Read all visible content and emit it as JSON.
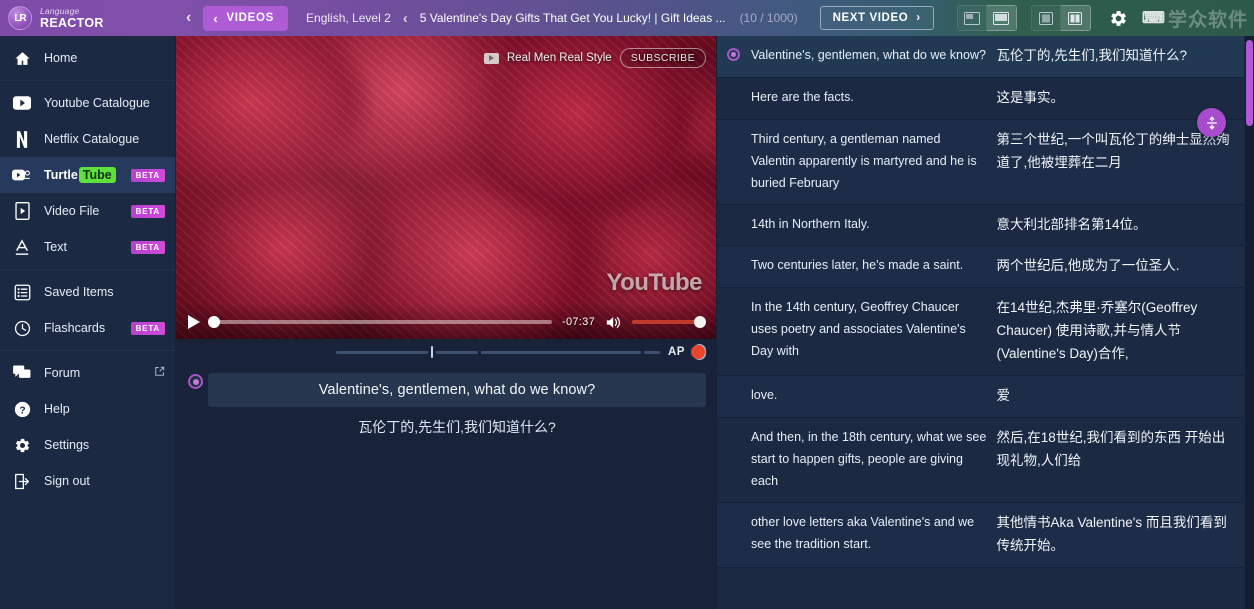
{
  "header": {
    "brand_top": "Language",
    "brand_bottom": "REACTOR",
    "brand_logo": "LR",
    "back_chevron": "‹",
    "videos_label": "VIDEOS",
    "videos_chevron": "‹",
    "language_level": "English, Level 2",
    "title_chevron": "‹",
    "video_title": "5 Valentine's Day Gifts That Get You Lucky! | Gift Ideas ...",
    "counter": "(10 / 1000)",
    "next_video_label": "NEXT VIDEO",
    "next_video_chevron": "›",
    "gear_icon": "gear-icon",
    "watermark": "学众软件",
    "accent_purple": "#ad5cd6",
    "accent_teal": "#2d5a4a"
  },
  "sidebar": {
    "items": [
      {
        "label": "Home",
        "icon": "home-icon",
        "badge": "",
        "active": false,
        "external": false
      },
      {
        "label": "Youtube Catalogue",
        "icon": "youtube-icon",
        "badge": "",
        "active": false,
        "external": false
      },
      {
        "label": "Netflix Catalogue",
        "icon": "netflix-icon",
        "badge": "",
        "active": false,
        "external": false
      },
      {
        "label": "TurtleTube",
        "icon": "turtletube-icon",
        "badge": "BETA",
        "active": true,
        "external": false
      },
      {
        "label": "Video File",
        "icon": "video-file-icon",
        "badge": "BETA",
        "active": false,
        "external": false
      },
      {
        "label": "Text",
        "icon": "text-icon",
        "badge": "BETA",
        "active": false,
        "external": false
      },
      {
        "label": "Saved Items",
        "icon": "saved-items-icon",
        "badge": "",
        "active": false,
        "external": false
      },
      {
        "label": "Flashcards",
        "icon": "clock-icon",
        "badge": "BETA",
        "active": false,
        "external": false
      },
      {
        "label": "Forum",
        "icon": "forum-icon",
        "badge": "",
        "active": false,
        "external": true
      },
      {
        "label": "Help",
        "icon": "help-icon",
        "badge": "",
        "active": false,
        "external": false
      },
      {
        "label": "Settings",
        "icon": "gear-icon",
        "badge": "",
        "active": false,
        "external": false
      },
      {
        "label": "Sign out",
        "icon": "sign-out-icon",
        "badge": "",
        "active": false,
        "external": false
      }
    ],
    "turtletube": {
      "part1": "Turtle",
      "part2": "Tube",
      "badge_color": "#5fe03a"
    }
  },
  "player": {
    "channel_name": "Real Men Real Style",
    "subscribe_label": "SUBSCRIBE",
    "youtube_watermark": "YouTube",
    "time_remaining": "-07:37",
    "play_icon": "play-icon",
    "volume_icon": "volume-icon",
    "auto_pause_label": "AP",
    "auto_pause_on": true
  },
  "subtitle": {
    "source": "Valentine's, gentlemen, what do we know?",
    "target": "瓦伦丁的,先生们,我们知道什么?"
  },
  "transcript": {
    "fab_icon": "expand-collapse-icon",
    "rows": [
      {
        "source": "Valentine's, gentlemen, what do we know?",
        "target": "瓦伦丁的,先生们,我们知道什么?",
        "active": true
      },
      {
        "source": "Here are the facts.",
        "target": "这是事实。",
        "active": false
      },
      {
        "source": "Third century, a gentleman named Valentin apparently is martyred and he is buried February",
        "target": "第三个世纪,一个叫瓦伦丁的绅士显然殉道了,他被埋葬在二月",
        "active": false
      },
      {
        "source": "14th in Northern Italy.",
        "target": "意大利北部排名第14位。",
        "active": false
      },
      {
        "source": "Two centuries later, he's made a saint.",
        "target": "两个世纪后,他成为了一位圣人.",
        "active": false
      },
      {
        "source": "In the 14th century, Geoffrey Chaucer uses poetry and associates Valentine's Day with",
        "target": "在14世纪,杰弗里·乔塞尔(Geoffrey Chaucer) 使用诗歌,并与情人节(Valentine's Day)合作,",
        "active": false
      },
      {
        "source": "love.",
        "target": "爱",
        "active": false
      },
      {
        "source": "And then, in the 18th century, what we see start to happen gifts, people are giving each",
        "target": "然后,在18世纪,我们看到的东西 开始出现礼物,人们给",
        "active": false
      },
      {
        "source": "other love letters aka Valentine's and we see the tradition start.",
        "target": "其他情书Aka Valentine's 而且我们看到传统开始。",
        "active": false
      }
    ]
  }
}
